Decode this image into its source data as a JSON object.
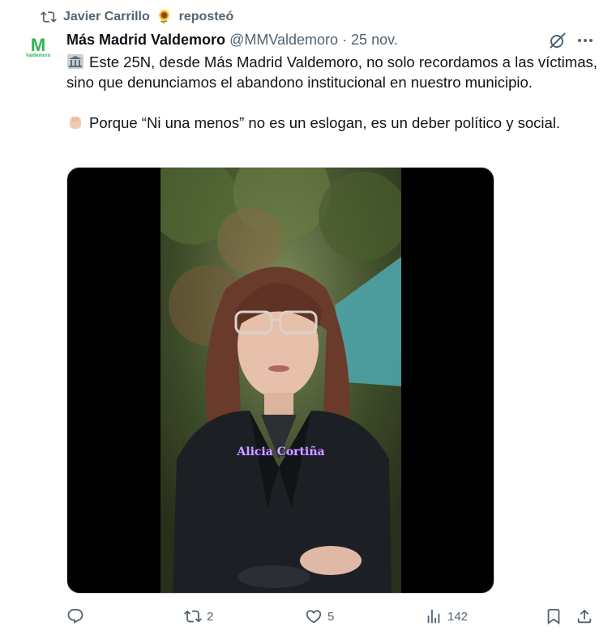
{
  "repost": {
    "user": "Javier Carrillo",
    "emoji": "🌻",
    "label": "reposteó"
  },
  "tweet": {
    "author_name": "Más Madrid Valdemoro",
    "handle": "@MMValdemoro",
    "separator": "·",
    "date": "25 nov.",
    "avatar_letter": "M",
    "avatar_sub": "Valdemoro",
    "paragraph1": "Este 25N, desde Más Madrid Valdemoro, no solo recordamos a las víctimas, sino que denunciamos el abandono institucional en nuestro municipio.",
    "paragraph2": "Porque “Ni una menos” no es un eslogan, es un deber político y social.",
    "video_caption": "Alicia Cortiña"
  },
  "actions": {
    "reply_count": "",
    "repost_count": "2",
    "like_count": "5",
    "views_count": "142"
  },
  "colors": {
    "muted": "#536471",
    "text": "#0f1419",
    "brand_green": "#2db553",
    "caption_purple": "#c9a8ff"
  },
  "icons": [
    "repost-icon",
    "sunflower-icon",
    "grok-icon",
    "more-icon",
    "institution-icon",
    "raised-fist-icon",
    "reply-icon",
    "like-icon",
    "views-icon",
    "bookmark-icon",
    "share-icon"
  ]
}
